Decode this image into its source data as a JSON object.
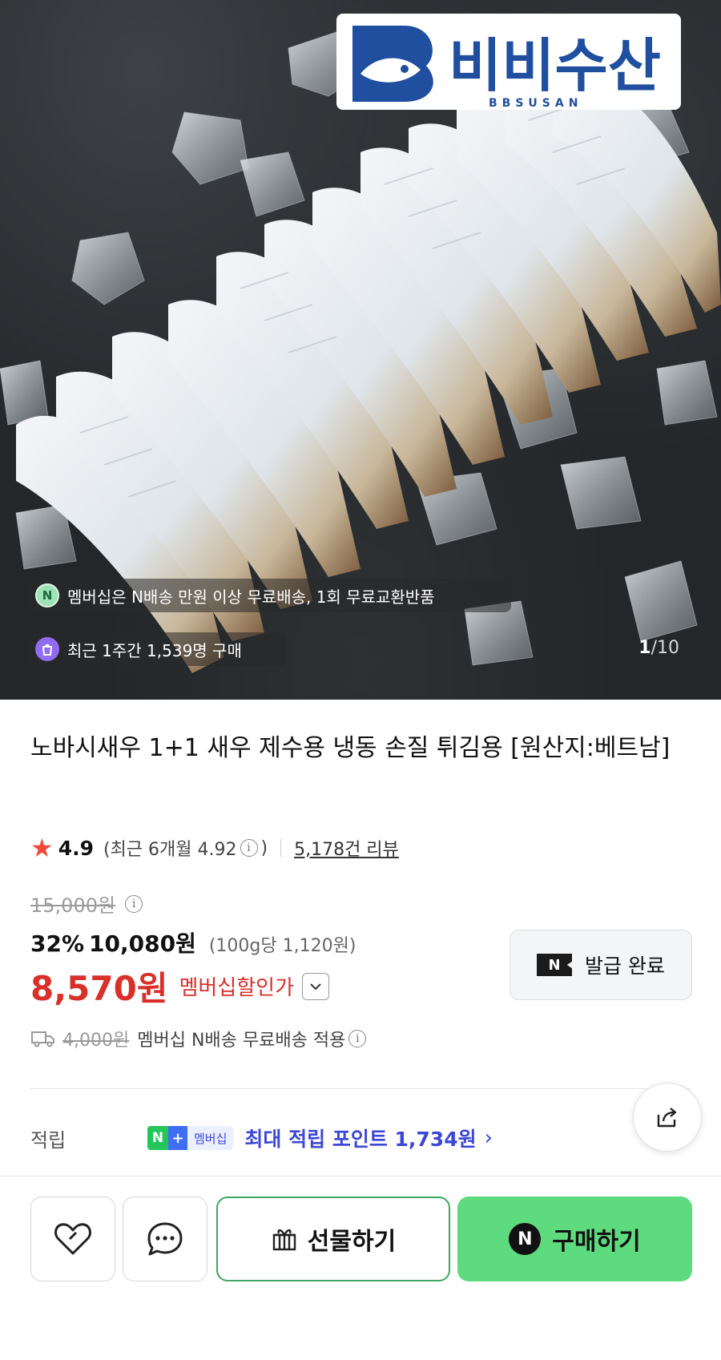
{
  "hero": {
    "brand_name": "비비수산",
    "brand_sub": "BBSUSAN",
    "membership_notice": "멤버십은 N배송 만원 이상 무료배송, 1회 무료교환반품",
    "recent_buyers": "최근 1주간 1,539명 구매",
    "pager_current": "1",
    "pager_sep": "/",
    "pager_total": "10",
    "icon_n_letter": "N"
  },
  "product": {
    "title": "노바시새우 1+1 새우 제수용 냉동 손질 튀김용 [원산지:베트남]",
    "rating": "4.9",
    "rating_recent": "(최근 6개월 4.92",
    "rating_recent_close": ")",
    "reviews": "5,178건 리뷰"
  },
  "price": {
    "original": "15,000원",
    "discount_rate": "32%",
    "sale": "10,080원",
    "unit": "(100g당 1,120원)",
    "member_price": "8,570원",
    "member_label": "멤버십할인가"
  },
  "coupon": {
    "label": "발급 완료",
    "n_letter": "N"
  },
  "shipping": {
    "original_fee": "4,000원",
    "text": "멤버십 N배송 무료배송 적용"
  },
  "points": {
    "label": "적립",
    "badge_n": "N",
    "badge_plus": "+",
    "badge_member": "멤버십",
    "text": "최대 적립 포인트 1,734원",
    "arrow": "›"
  },
  "actions": {
    "gift": "선물하기",
    "buy": "구매하기",
    "buy_n": "N"
  },
  "colors": {
    "accent_red": "#d9302a",
    "point_blue": "#3d47d6",
    "buy_green": "#5fdb7f",
    "gift_border": "#3ea763",
    "star": "#f04a3a"
  }
}
